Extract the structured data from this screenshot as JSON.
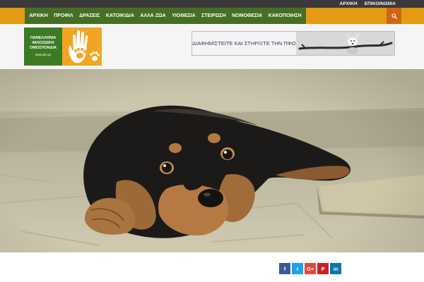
{
  "topbar": {
    "links": [
      "ΑΡΧΙΚΗ",
      "ΕΠΙΚΟΙΝΩΝΙΑ"
    ]
  },
  "nav": {
    "items": [
      "ΑΡΧΙΚΗ",
      "ΠΡΟΦΙΛ",
      "ΔΡΑΣΕΙΣ",
      "ΚΑΤΟΙΚΙΔΙΑ",
      "ΑΛΛΑ ΖΩΑ",
      "ΥΙΟΘΕΣΙΑ",
      "ΣΤΕΙΡΩΣΗ",
      "ΝΟΜΟΘΕΣΙΑ",
      "ΚΑΚΟΠΟΙΗΣΗ"
    ]
  },
  "search": {
    "icon": "search-icon"
  },
  "logo": {
    "lines": [
      "ΠΑΝΕΛΛΗΝΙΑ",
      "ΦΙΛΟΖΩΙΚΗ",
      "ΟΜΟΣΠΟΝΔΙΑ"
    ],
    "url": "www.pfo.gr",
    "icon": "hand-paw-icon"
  },
  "banner": {
    "text": "ΔΙΑΦΗΜΙΣΤΕΙΤΕ ΚΑΙ ΣΤΗΡΙΞΤΕ ΤΗΝ ΠΦΟ"
  },
  "social": {
    "buttons": [
      "f",
      "t",
      "G+",
      "P",
      "in"
    ]
  },
  "colors": {
    "topbar": "#3a3a3a",
    "nav_orange": "#e39b13",
    "nav_green": "#456f22",
    "search_bg": "#d2650f",
    "facebook": "#3b5998",
    "twitter": "#1da1f2",
    "googleplus": "#dd4b39",
    "pinterest": "#cb2027",
    "linkedin": "#0e76a8"
  }
}
